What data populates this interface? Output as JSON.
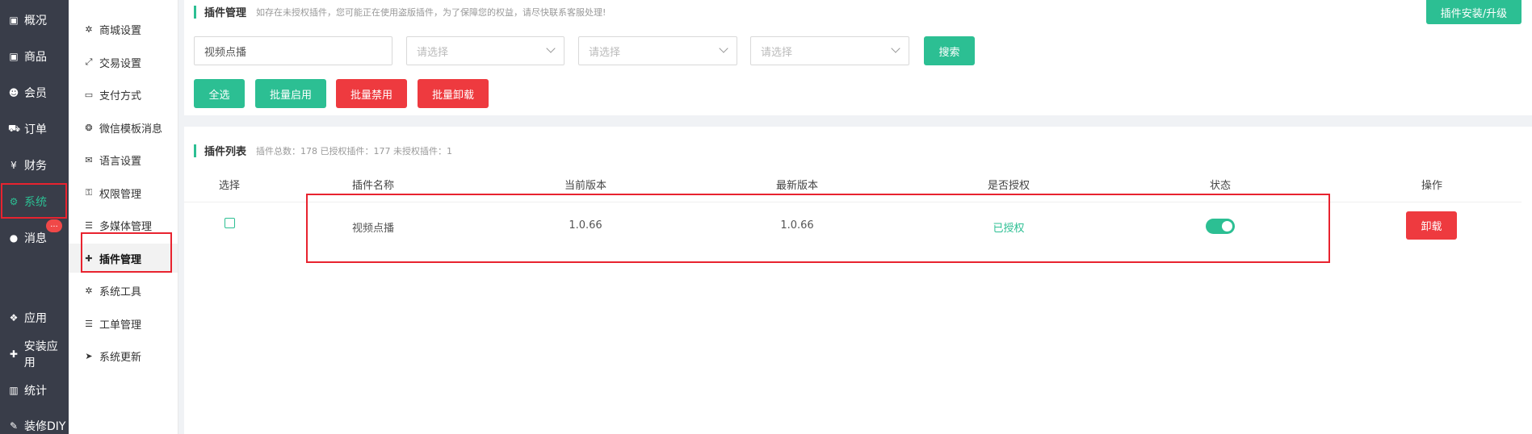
{
  "sidebar_primary": {
    "items": [
      {
        "label": "概况",
        "icon": "chart-icon",
        "glyph": "▣"
      },
      {
        "label": "商品",
        "icon": "box-icon",
        "glyph": "▣"
      },
      {
        "label": "会员",
        "icon": "users-icon",
        "glyph": "☻"
      },
      {
        "label": "订单",
        "icon": "cart-icon",
        "glyph": "⛟"
      },
      {
        "label": "财务",
        "icon": "yen-icon",
        "glyph": "¥"
      },
      {
        "label": "系统",
        "icon": "gears-icon",
        "glyph": "⚙"
      },
      {
        "label": "消息",
        "icon": "chat-icon",
        "glyph": "●"
      },
      {
        "label": "应用",
        "icon": "apps-icon",
        "glyph": "❖"
      },
      {
        "label": "安装应用",
        "icon": "puzzle-icon",
        "glyph": "✚"
      },
      {
        "label": "统计",
        "icon": "bar-chart-icon",
        "glyph": "▥"
      },
      {
        "label": "装修DIY",
        "icon": "hammer-icon",
        "glyph": "✎"
      }
    ],
    "badge": "...",
    "active_color": "#2cbf93"
  },
  "sidebar_secondary": {
    "items": [
      {
        "label": "商城设置",
        "icon": "gear-icon",
        "glyph": "✲"
      },
      {
        "label": "交易设置",
        "icon": "exchange-icon",
        "glyph": "⤢"
      },
      {
        "label": "支付方式",
        "icon": "card-icon",
        "glyph": "▭"
      },
      {
        "label": "微信模板消息",
        "icon": "wechat-icon",
        "glyph": "❂"
      },
      {
        "label": "语言设置",
        "icon": "language-icon",
        "glyph": "✉"
      },
      {
        "label": "权限管理",
        "icon": "key-icon",
        "glyph": "⚿"
      },
      {
        "label": "多媒体管理",
        "icon": "list-icon",
        "glyph": "☰"
      },
      {
        "label": "插件管理",
        "icon": "puzzle-icon",
        "glyph": "✚"
      },
      {
        "label": "系统工具",
        "icon": "gear-icon",
        "glyph": "✲"
      },
      {
        "label": "工单管理",
        "icon": "list-icon",
        "glyph": "☰"
      },
      {
        "label": "系统更新",
        "icon": "send-icon",
        "glyph": "➤"
      }
    ]
  },
  "plugin_manage": {
    "title": "插件管理",
    "desc": "如存在未授权插件，您可能正在使用盗版插件，为了保障您的权益，请尽快联系客服处理!",
    "install_button": "插件安装/升级",
    "search_input_value": "视频点播",
    "select_placeholder": "请选择",
    "search_button": "搜索",
    "actions": {
      "select_all": "全选",
      "batch_enable": "批量启用",
      "batch_disable": "批量禁用",
      "batch_uninstall": "批量卸载"
    }
  },
  "plugin_list": {
    "title": "插件列表",
    "summary": "插件总数：178 已授权插件：177 未授权插件：1",
    "columns": [
      "选择",
      "插件名称",
      "当前版本",
      "最新版本",
      "是否授权",
      "状态",
      "操作"
    ],
    "rows": [
      {
        "name": "视频点播",
        "current_version": "1.0.66",
        "latest_version": "1.0.66",
        "authorized": "已授权",
        "enabled": true,
        "action": "卸载"
      }
    ]
  },
  "colors": {
    "primary": "#2cbf93",
    "danger": "#ee3a3f",
    "highlight": "#e8232f"
  }
}
